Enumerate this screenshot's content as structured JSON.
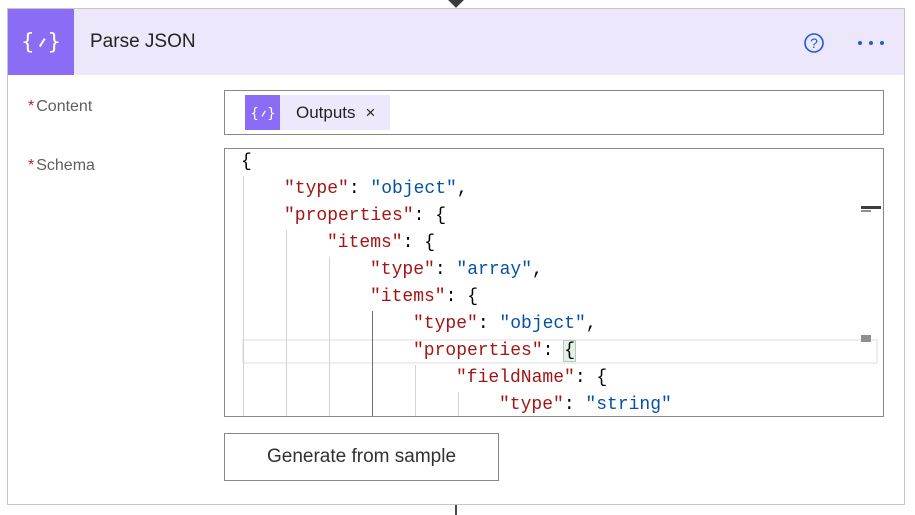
{
  "action": {
    "title": "Parse JSON",
    "icon": "json-braces-icon",
    "accent_color": "#8a6cf5",
    "header_background": "#ece7fb",
    "help_icon": "question-circle-icon",
    "more_icon": "ellipsis-icon"
  },
  "fields": {
    "content": {
      "required_marker": "*",
      "label": "Content",
      "token": {
        "label": "Outputs",
        "remove_glyph": "×",
        "icon": "json-braces-icon"
      }
    },
    "schema": {
      "required_marker": "*",
      "label": "Schema",
      "lines": [
        {
          "indent": 0,
          "parts": [
            {
              "t": "punc",
              "v": "{"
            }
          ]
        },
        {
          "indent": 1,
          "parts": [
            {
              "t": "key",
              "v": "\"type\""
            },
            {
              "t": "punc",
              "v": ": "
            },
            {
              "t": "str",
              "v": "\"object\""
            },
            {
              "t": "punc",
              "v": ","
            }
          ]
        },
        {
          "indent": 1,
          "parts": [
            {
              "t": "key",
              "v": "\"properties\""
            },
            {
              "t": "punc",
              "v": ": {"
            }
          ]
        },
        {
          "indent": 2,
          "parts": [
            {
              "t": "key",
              "v": "\"items\""
            },
            {
              "t": "punc",
              "v": ": {"
            }
          ]
        },
        {
          "indent": 3,
          "parts": [
            {
              "t": "key",
              "v": "\"type\""
            },
            {
              "t": "punc",
              "v": ": "
            },
            {
              "t": "str",
              "v": "\"array\""
            },
            {
              "t": "punc",
              "v": ","
            }
          ]
        },
        {
          "indent": 3,
          "parts": [
            {
              "t": "key",
              "v": "\"items\""
            },
            {
              "t": "punc",
              "v": ": {"
            }
          ]
        },
        {
          "indent": 4,
          "parts": [
            {
              "t": "key",
              "v": "\"type\""
            },
            {
              "t": "punc",
              "v": ": "
            },
            {
              "t": "str",
              "v": "\"object\""
            },
            {
              "t": "punc",
              "v": ","
            }
          ]
        },
        {
          "indent": 4,
          "parts": [
            {
              "t": "key",
              "v": "\"properties\""
            },
            {
              "t": "punc",
              "v": ": "
            },
            {
              "t": "hl",
              "v": "{"
            }
          ]
        },
        {
          "indent": 5,
          "parts": [
            {
              "t": "key",
              "v": "\"fieldName\""
            },
            {
              "t": "punc",
              "v": ": {"
            }
          ]
        },
        {
          "indent": 6,
          "parts": [
            {
              "t": "key",
              "v": "\"type\""
            },
            {
              "t": "punc",
              "v": ": "
            },
            {
              "t": "str",
              "v": "\"string\""
            }
          ]
        }
      ]
    }
  },
  "buttons": {
    "generate_label": "Generate from sample"
  },
  "colors": {
    "json_key": "#a31515",
    "json_string": "#0451a5",
    "required": "#a4262c"
  }
}
